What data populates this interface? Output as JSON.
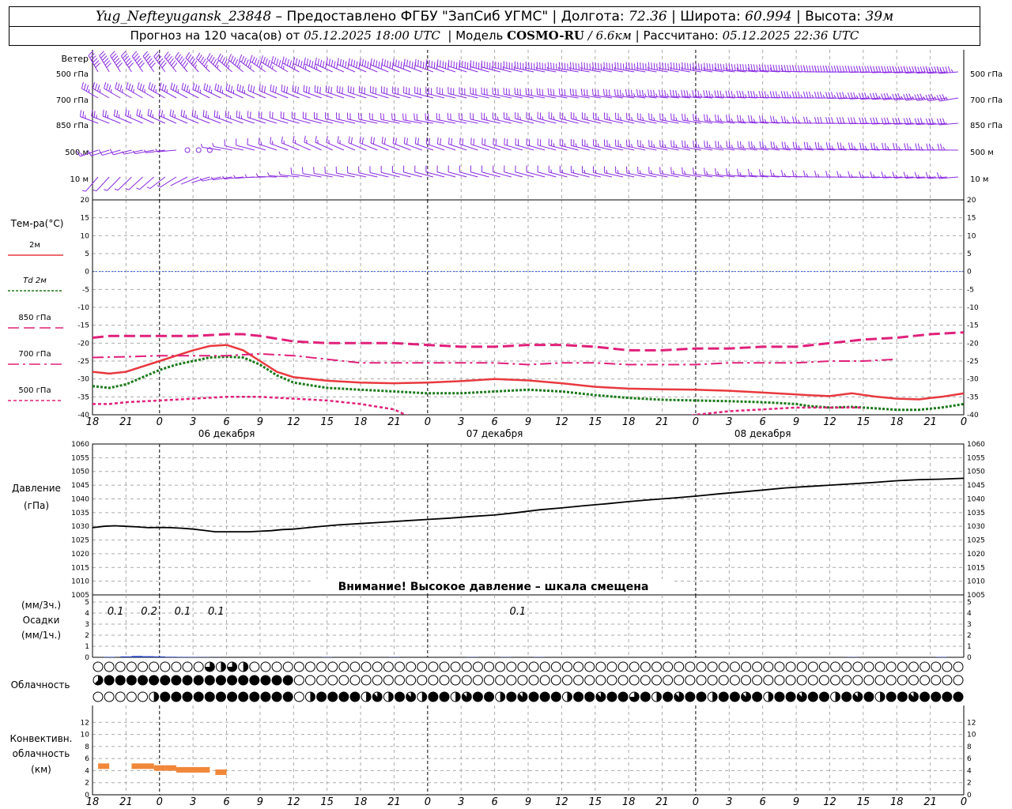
{
  "header": {
    "station": "Yug_Nefteyugansk_23848",
    "provider": "– Предоставлено ФГБУ \"ЗапСиб УГМС\"",
    "lon_label": "Долгота:",
    "lon_value": "72.36",
    "lat_label": "Широта:",
    "lat_value": "60.994",
    "alt_label": "Высота:",
    "alt_value": "39м",
    "forecast_label": "Прогноз на 120 часа(ов) от",
    "forecast_start": "05.12.2025 18:00 UTC",
    "model_label": "Модель",
    "model_name": "COSMO-RU",
    "model_res": "/ 6.6км",
    "calc_label": "Рассчитано:",
    "calc_time": "05.12.2025 22:36 UTC"
  },
  "time_axis": {
    "start_hour": 18,
    "step_hours": 3,
    "num_ticks": 27,
    "tick_labels": [
      "18",
      "21",
      "0",
      "3",
      "6",
      "9",
      "12",
      "15",
      "18",
      "21",
      "0",
      "3",
      "6",
      "9",
      "12",
      "15",
      "18",
      "21",
      "0",
      "3",
      "6",
      "9",
      "12",
      "15",
      "18",
      "21",
      "0"
    ],
    "date_labels": [
      "06 декабря",
      "07 декабря",
      "08 декабря"
    ],
    "date_label_positions_hours": [
      12,
      36,
      60
    ],
    "midnight_offsets_hours": [
      6,
      30,
      54
    ],
    "end_offset_hours": 78
  },
  "wind": {
    "label": "Ветер",
    "levels": [
      "500 гПа",
      "700 гПа",
      "850 гПа",
      "500 м",
      "10 м"
    ],
    "color": "#8a2be2",
    "sample_step_hours": 1,
    "dir_deg": {
      "500 гПа": [
        [
          0,
          330
        ],
        [
          6,
          325
        ],
        [
          20,
          295
        ],
        [
          30,
          290
        ],
        [
          42,
          280
        ],
        [
          54,
          280
        ],
        [
          66,
          270
        ],
        [
          78,
          265
        ]
      ],
      "700 гПа": [
        [
          0,
          300
        ],
        [
          6,
          300
        ],
        [
          20,
          290
        ],
        [
          30,
          285
        ],
        [
          42,
          280
        ],
        [
          54,
          275
        ],
        [
          66,
          270
        ],
        [
          78,
          260
        ]
      ],
      "850 гПа": [
        [
          0,
          290
        ],
        [
          6,
          295
        ],
        [
          20,
          285
        ],
        [
          30,
          280
        ],
        [
          42,
          285
        ],
        [
          54,
          280
        ],
        [
          66,
          270
        ],
        [
          78,
          265
        ]
      ],
      "500 м": [
        [
          0,
          250
        ],
        [
          6,
          260
        ],
        [
          12,
          280
        ],
        [
          20,
          295
        ],
        [
          30,
          290
        ],
        [
          42,
          285
        ],
        [
          54,
          280
        ],
        [
          66,
          275
        ],
        [
          78,
          270
        ]
      ],
      "10 м": [
        [
          0,
          220
        ],
        [
          6,
          230
        ],
        [
          12,
          260
        ],
        [
          20,
          280
        ],
        [
          30,
          285
        ],
        [
          42,
          285
        ],
        [
          54,
          280
        ],
        [
          66,
          270
        ],
        [
          78,
          265
        ]
      ]
    },
    "speed_ms": {
      "500 гПа": [
        [
          0,
          25
        ],
        [
          30,
          20
        ],
        [
          54,
          18
        ],
        [
          78,
          22
        ]
      ],
      "700 гПа": [
        [
          0,
          15
        ],
        [
          30,
          12
        ],
        [
          54,
          14
        ],
        [
          78,
          15
        ]
      ],
      "850 гПа": [
        [
          0,
          10
        ],
        [
          30,
          9
        ],
        [
          54,
          11
        ],
        [
          78,
          12
        ]
      ],
      "500 м": [
        [
          0,
          6
        ],
        [
          10,
          0
        ],
        [
          14,
          5
        ],
        [
          30,
          9
        ],
        [
          54,
          10
        ],
        [
          78,
          11
        ]
      ],
      "10 м": [
        [
          0,
          3
        ],
        [
          10,
          1
        ],
        [
          16,
          3
        ],
        [
          30,
          5
        ],
        [
          54,
          6
        ],
        [
          78,
          6
        ]
      ]
    }
  },
  "temperature": {
    "title": "Тем-ра(°C)",
    "ylim": [
      -40,
      20
    ],
    "ticks": [
      20,
      15,
      10,
      5,
      0,
      -5,
      -10,
      -15,
      -20,
      -25,
      -30,
      -35,
      -40
    ]
  },
  "pressure": {
    "title": "Давление",
    "unit": "(гПа)",
    "ylim": [
      1005,
      1060
    ],
    "ticks": [
      1060,
      1055,
      1050,
      1045,
      1040,
      1035,
      1030,
      1025,
      1020,
      1015,
      1010,
      1005
    ],
    "warning": "Внимание! Высокое давление – шкала смещена"
  },
  "precip": {
    "label_top": "(мм/3ч.)",
    "label_mid": "Осадки",
    "label_bot": "(мм/1ч.)",
    "ylim": [
      0,
      5
    ],
    "ticks": [
      5,
      4,
      3,
      2,
      1,
      0
    ],
    "totals": [
      {
        "h": 1.5,
        "text": "0.1"
      },
      {
        "h": 4.5,
        "text": "0.2"
      },
      {
        "h": 7.5,
        "text": "0.1"
      },
      {
        "h": 10.5,
        "text": "0.1"
      },
      {
        "h": 37.5,
        "text": "0.1"
      }
    ],
    "color": "#1f3fbf",
    "hourly": [
      [
        1.5,
        0.04
      ],
      [
        3,
        0.08
      ],
      [
        4,
        0.12
      ],
      [
        5,
        0.1
      ],
      [
        6,
        0.08
      ],
      [
        7,
        0.05
      ],
      [
        8,
        0.04
      ],
      [
        9,
        0.03
      ],
      [
        10,
        0.02
      ],
      [
        11,
        0.01
      ],
      [
        21,
        0.02
      ],
      [
        27,
        0.02
      ],
      [
        34,
        0.02
      ],
      [
        37,
        0.02
      ],
      [
        40,
        0.02
      ],
      [
        68,
        0.02
      ],
      [
        76,
        0.03
      ]
    ]
  },
  "cloud": {
    "label": "Облачность",
    "rows": [
      {
        "name": "high",
        "runs": [
          [
            0,
            1,
            0
          ],
          [
            10,
            78,
            0
          ]
        ],
        "special": [
          [
            10,
            0.75
          ],
          [
            11,
            0.5
          ],
          [
            12,
            0.75
          ],
          [
            13,
            0.5
          ]
        ]
      },
      {
        "name": "middle",
        "runs": [
          [
            0,
            1,
            0.625
          ],
          [
            1,
            18,
            1
          ],
          [
            18,
            78,
            0
          ]
        ],
        "special": []
      },
      {
        "name": "low",
        "runs": [
          [
            0,
            5,
            0
          ],
          [
            5,
            6,
            0.5
          ],
          [
            6,
            18,
            1
          ],
          [
            18,
            19,
            0
          ],
          [
            19,
            20,
            0.5
          ],
          [
            20,
            78,
            1
          ]
        ],
        "special": [
          [
            24,
            0.5
          ],
          [
            25,
            0.875
          ],
          [
            26,
            0.5
          ],
          [
            28,
            0.875
          ],
          [
            29,
            0.5
          ],
          [
            32,
            0.5
          ],
          [
            33,
            0.875
          ],
          [
            36,
            0.5
          ],
          [
            38,
            0.875
          ],
          [
            42,
            0.5
          ],
          [
            45,
            0.875
          ],
          [
            48,
            0.75
          ],
          [
            50,
            0.5
          ],
          [
            52,
            0.875
          ],
          [
            55,
            0.5
          ],
          [
            58,
            0.875
          ],
          [
            60,
            0.5
          ],
          [
            63,
            0.875
          ],
          [
            66,
            0.5
          ],
          [
            68,
            0.875
          ],
          [
            70,
            0.5
          ],
          [
            73,
            0.875
          ]
        ]
      }
    ]
  },
  "convective": {
    "label1": "Конвективн.",
    "label2": "облачность",
    "label3": "(км)",
    "ylim": [
      0,
      14
    ],
    "ticks": [
      12,
      10,
      8,
      6,
      4,
      2,
      0
    ],
    "color": "#f0873a",
    "bars": [
      [
        0.5,
        1.5,
        4.8
      ],
      [
        3.5,
        5.5,
        4.8
      ],
      [
        5.5,
        6.5,
        4.5
      ],
      [
        6.5,
        7.5,
        4.5
      ],
      [
        7.5,
        10.5,
        4.2
      ],
      [
        11,
        12,
        3.8
      ]
    ]
  },
  "chart_data": {
    "type": "line",
    "title": "",
    "x": [
      0,
      3,
      6,
      9,
      12,
      15,
      18,
      21,
      24,
      27,
      30,
      33,
      36,
      39,
      42,
      45,
      48,
      51,
      54,
      57,
      60,
      63,
      66,
      69,
      72,
      75,
      78
    ],
    "x_tick_labels": [
      "18",
      "21",
      "0",
      "3",
      "6",
      "9",
      "12",
      "15",
      "18",
      "21",
      "0",
      "3",
      "6",
      "9",
      "12",
      "15",
      "18",
      "21",
      "0",
      "3",
      "6",
      "9",
      "12",
      "15",
      "18",
      "21",
      "0"
    ],
    "temperature_series": [
      {
        "name": "2м",
        "color": "#e8393e",
        "style": "solid",
        "values": [
          -28,
          -28.5,
          -28,
          -26.5,
          -25,
          -23.5,
          -22,
          -20.8,
          -20.5,
          -22,
          -25,
          -28,
          -29.5,
          -30.5,
          -31,
          -31.2,
          -31,
          -30.6,
          -30,
          -30.4,
          -31.2,
          -32.2,
          -32.7,
          -32.9,
          -33,
          -33.3,
          -33.8,
          -34.3,
          -34.5,
          -34.8,
          -34,
          -34.9,
          -35.5,
          -35.7,
          -35.3,
          -35,
          -34.5,
          -34
        ]
      },
      {
        "name": "Td 2м",
        "color": "#1a7a1a",
        "style": "dotted",
        "values": [
          -32,
          -32.5,
          -31.5,
          -29.5,
          -27.5,
          -26,
          -25,
          -24,
          -23.8,
          -24,
          -26,
          -29,
          -31,
          -32.5,
          -33,
          -33.5,
          -34,
          -34,
          -33.5,
          -33,
          -33.5,
          -34.5,
          -35.3,
          -35.8,
          -36,
          -36.2,
          -36.5,
          -37,
          -37.5,
          -38,
          -37.8,
          -38.2,
          -38.6,
          -38.6,
          -38.3,
          -38,
          -37.5,
          -37
        ]
      },
      {
        "name": "850 гПа",
        "color": "#e0207a",
        "style": "long-dash",
        "values": [
          -18.5,
          -18,
          -18,
          -18,
          -18,
          -17.5,
          -17.5,
          -18,
          -19.5,
          -20,
          -20,
          -20,
          -20.5,
          -21,
          -21,
          -20.5,
          -20.5,
          -21,
          -22,
          -22,
          -21.5,
          -21.5,
          -21,
          -21,
          -20,
          -19,
          -18.5,
          -17.5,
          -17
        ]
      },
      {
        "name": "700 гПа",
        "color": "#e0207a",
        "style": "dash-dot",
        "values": [
          -24,
          -23.8,
          -23.5,
          -23.5,
          -23.5,
          -23,
          -23.5,
          -24.5,
          -25.5,
          -25.5,
          -25.5,
          -25.5,
          -25.5,
          -26,
          -25.5,
          -25.5,
          -26,
          -26,
          -26,
          -25.5,
          -25.5,
          -25.5,
          -25,
          -25,
          -24.5
        ]
      },
      {
        "name": "500 гПа",
        "color": "#e0207a",
        "style": "short-dash",
        "values": [
          -37,
          -37,
          -36.5,
          -36,
          -35.5,
          -35,
          -35,
          -35.5,
          -36,
          -37,
          -38.5,
          -40,
          -41,
          -42,
          -43,
          -43,
          -43,
          -43,
          -42.5,
          -42,
          -41.5,
          -40,
          -39,
          -38.5,
          -38,
          -38,
          -38
        ]
      }
    ],
    "temperature_hours": {
      "2м": [
        0,
        1.5,
        3,
        4.5,
        6,
        7.5,
        9,
        10.5,
        12,
        13.5,
        15,
        16.5,
        18,
        21,
        24,
        27,
        30,
        33,
        36,
        39,
        42,
        45,
        48,
        51,
        54,
        57,
        60,
        63,
        64,
        66,
        68,
        70,
        72,
        74,
        75,
        76,
        77,
        78
      ],
      "Td 2м": [
        0,
        1.5,
        3,
        4.5,
        6,
        7.5,
        9,
        10.5,
        12,
        13.5,
        15,
        16.5,
        18,
        21,
        24,
        27,
        30,
        33,
        36,
        39,
        42,
        45,
        48,
        51,
        54,
        57,
        60,
        63,
        64,
        66,
        68,
        70,
        72,
        74,
        75,
        76,
        77,
        78
      ],
      "850 гПа": [
        0,
        1.5,
        3,
        6,
        9,
        12,
        13.5,
        15,
        18,
        21,
        24,
        27,
        30,
        33,
        36,
        39,
        42,
        45,
        48,
        51,
        54,
        57,
        60,
        63,
        66,
        69,
        72,
        75,
        78
      ],
      "700 гПа": [
        0,
        3,
        6,
        9,
        12,
        15,
        18,
        21,
        24,
        27,
        30,
        33,
        36,
        39,
        42,
        45,
        48,
        51,
        54,
        57,
        60,
        63,
        66,
        69,
        72
      ],
      "500 гПа": [
        0,
        1.5,
        3,
        6,
        9,
        12,
        15,
        18,
        21,
        24,
        27,
        28,
        29,
        30,
        33,
        36,
        39,
        42,
        45,
        48,
        51,
        54,
        57,
        60,
        63,
        66,
        69
      ],
      "note": ""
    },
    "pressure_series": {
      "name": "Давление",
      "color": "#000000",
      "hours": [
        0,
        1,
        2,
        3,
        4,
        5,
        6,
        7,
        8,
        9,
        10,
        11,
        12,
        13,
        14,
        15,
        16,
        17,
        18,
        20,
        22,
        24,
        26,
        28,
        30,
        32,
        34,
        36,
        38,
        40,
        42,
        44,
        46,
        48,
        50,
        52,
        54,
        56,
        58,
        60,
        62,
        64,
        66,
        68,
        70,
        72,
        74,
        76,
        78
      ],
      "values": [
        1029.5,
        1030,
        1030.2,
        1030,
        1029.8,
        1029.5,
        1029.6,
        1029.5,
        1029.3,
        1029,
        1028.5,
        1028,
        1028,
        1028,
        1028,
        1028.2,
        1028.4,
        1028.8,
        1029,
        1029.8,
        1030.5,
        1031,
        1031.5,
        1032,
        1032.5,
        1033,
        1033.6,
        1034.1,
        1035,
        1036,
        1036.7,
        1037.5,
        1038.2,
        1039,
        1039.7,
        1040.3,
        1041,
        1041.8,
        1042.5,
        1043.2,
        1044,
        1044.5,
        1045,
        1045.5,
        1046,
        1046.6,
        1047,
        1047.2,
        1047.5
      ]
    },
    "xlabel": "",
    "ylabel": "",
    "grid": true
  },
  "legend": {
    "items": [
      {
        "label": "2м",
        "color": "#e8393e",
        "style": "solid"
      },
      {
        "label": "2м",
        "prefix": "Td",
        "color": "#1a7a1a",
        "style": "dotted"
      },
      {
        "label": "850 гПа",
        "color": "#e0207a",
        "style": "long-dash"
      },
      {
        "label": "700 гПа",
        "color": "#e0207a",
        "style": "dash-dot"
      },
      {
        "label": "500 гПа",
        "color": "#e0207a",
        "style": "short-dash"
      }
    ]
  }
}
